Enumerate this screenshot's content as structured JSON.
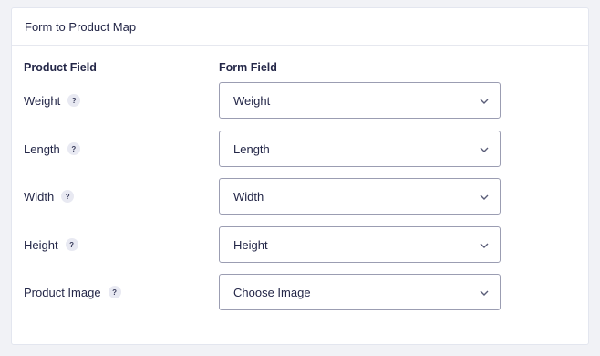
{
  "panel": {
    "title": "Form to Product Map"
  },
  "columns": {
    "product_field": "Product Field",
    "form_field": "Form Field"
  },
  "help_glyph": "?",
  "rows": [
    {
      "label": "Weight",
      "value": "Weight"
    },
    {
      "label": "Length",
      "value": "Length"
    },
    {
      "label": "Width",
      "value": "Width"
    },
    {
      "label": "Height",
      "value": "Height"
    },
    {
      "label": "Product Image",
      "value": "Choose Image"
    }
  ],
  "colors": {
    "text": "#242748",
    "border": "#9b9db2",
    "help_bg": "#e8e9f2"
  },
  "icons": {
    "help": "question-mark-icon",
    "select": "chevron-down-icon"
  }
}
